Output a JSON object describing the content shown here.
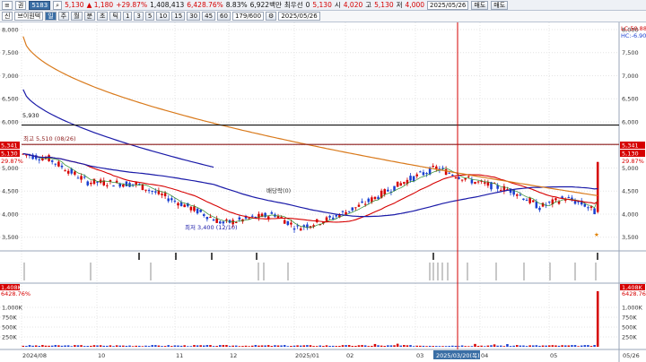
{
  "header": {
    "menu": "≡",
    "mode_label": "권",
    "code": "5183",
    "search_icon": "search-icon",
    "price": "5,130",
    "change": "▲ 1,180",
    "change_pct": "+29.87%",
    "volume": "1,408,413",
    "vol_ratio": "6,428.76%",
    "turnover_rate": "8.83%",
    "amount": "6,922백만",
    "pref_label": "최우선",
    "pref_value": "0",
    "current": "5,130",
    "open_label": "시",
    "open": "4,020",
    "high_label": "고",
    "high": "5,130",
    "low_label": "저",
    "low": "4,000",
    "date": "2025/05/26",
    "btn_sell": "매도",
    "btn_buy": "매도"
  },
  "toolbar": {
    "type_label": "신",
    "name_label": "브이원텍",
    "periods": [
      "주",
      "월",
      "분",
      "초",
      "틱"
    ],
    "minutes": [
      "1",
      "3",
      "5",
      "10",
      "15",
      "30",
      "45",
      "60"
    ],
    "count": "179/600",
    "date": "2025/05/26"
  },
  "chart_data": {
    "type": "candlestick",
    "y_ticks": [
      "8,000",
      "7,500",
      "7,000",
      "6,500",
      "6,000",
      "5,500",
      "5,000",
      "4,500",
      "4,000",
      "3,500"
    ],
    "x_ticks": [
      "2024/08",
      "10",
      "11",
      "12",
      "2025/01",
      "02",
      "03",
      "04",
      "05",
      "05/26"
    ],
    "crosshair_date": "2025/03/20(목)",
    "hlines": [
      {
        "label": "5,930",
        "value": 5930
      },
      {
        "label": "5,510",
        "value": 5510
      }
    ],
    "annotations": {
      "high": "최고 5,510 (08/26)",
      "low": "최저 3,400 (12/10)",
      "dividend": "배당락(0)",
      "lc": "LC:50.88",
      "hc": "HC:-6.90",
      "right_price": "5,341",
      "right_current": "5,130",
      "right_pct": "29.87%",
      "left_price": "5,341",
      "left_current": "5,130",
      "left_pct": "29.87%",
      "left_ref": "5,930"
    },
    "volume_panel": {
      "y_ticks": [
        "1,000K",
        "750K",
        "500K",
        "250K"
      ],
      "top_label": "1,408K",
      "top_pct": "6428.76%",
      "last_volume": 1408413
    },
    "colors": {
      "up": "#d60000",
      "down": "#1a3fd0",
      "ma_long": "#d97a1c",
      "ma_mid": "#1a1aa8",
      "ma_short": "#d60000"
    }
  }
}
